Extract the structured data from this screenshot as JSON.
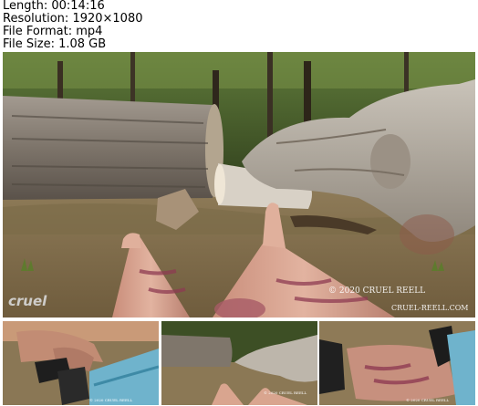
{
  "file_info": {
    "length_line": "Length: 00:14:16",
    "resolution_line": "Resolution: 1920×1080",
    "format_line": "File Format: mp4",
    "size_line": "File Size: 1.08 GB"
  },
  "main_frame": {
    "watermark_logo": "cruel",
    "copyright_line": "© 2020 CRUEL REELL",
    "site_line": "CRUEL-REELL.COM"
  },
  "thumbnails": [
    {
      "watermark": "© 2020 CRUEL REELL"
    },
    {
      "watermark": "© 2020 CRUEL REELL"
    },
    {
      "watermark": "© 2020 CRUEL REELL"
    }
  ],
  "colors": {
    "forest_dark": "#2f3a1c",
    "log_bark": "#8a7f73",
    "ground": "#8c7752",
    "skin": "#d9a58f",
    "bruise": "#8e3b52",
    "leggings": "#6fb3cc"
  }
}
